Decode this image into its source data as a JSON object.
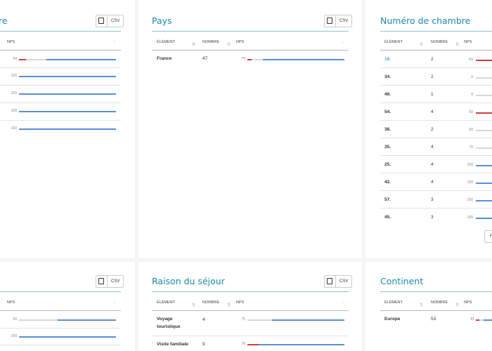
{
  "export": {
    "csv_label": "CSV"
  },
  "headers": {
    "element": "ÉLÉMENT",
    "count": "NOMBRE",
    "nps": "NPS",
    "sort_up": "↑",
    "sort_both": "⇅"
  },
  "card_top_left": {
    "title": "re",
    "rows": [
      {
        "nps": "64",
        "value": 64
      },
      {
        "nps": "100",
        "value": 100
      },
      {
        "nps": "100",
        "value": 100
      },
      {
        "nps": "100",
        "value": 100
      },
      {
        "nps": "100",
        "value": 100
      }
    ]
  },
  "card_pays": {
    "title": "Pays",
    "rows": [
      {
        "element": "France",
        "count": "47",
        "nps": "79",
        "value": 79
      }
    ]
  },
  "card_chambre": {
    "title": "Numéro de chambre",
    "pager_label": "F",
    "rows": [
      {
        "element": "16.",
        "count": "2",
        "nps": "-50",
        "value": -50
      },
      {
        "element": "34.",
        "count": "2",
        "nps": "0",
        "value": 0
      },
      {
        "element": "46.",
        "count": "1",
        "nps": "0",
        "value": 0
      },
      {
        "element": "54.",
        "count": "4",
        "nps": "50",
        "value": 50
      },
      {
        "element": "36.",
        "count": "2",
        "nps": "50",
        "value": 50
      },
      {
        "element": "35.",
        "count": "4",
        "nps": "75",
        "value": 75
      },
      {
        "element": "25.",
        "count": "4",
        "nps": "100",
        "value": 100
      },
      {
        "element": "42.",
        "count": "4",
        "nps": "100",
        "value": 100
      },
      {
        "element": "57.",
        "count": "3",
        "nps": "100",
        "value": 100
      },
      {
        "element": "45.",
        "count": "3",
        "nps": "100",
        "value": 100
      }
    ]
  },
  "card_bottom_left": {
    "rows": [
      {
        "nps": "60",
        "value": 60
      },
      {
        "nps": "100",
        "value": 100
      }
    ]
  },
  "card_raison": {
    "title": "Raison du séjour",
    "rows": [
      {
        "element": "Voyage touristique",
        "line1": "Voyage",
        "line2": "touristique",
        "count": "4",
        "nps": "75",
        "value": 75
      },
      {
        "element": "Visite familiale",
        "count": "9",
        "nps": "78",
        "value": 78
      }
    ]
  },
  "card_continent": {
    "title": "Continent",
    "rows": [
      {
        "element": "Europe",
        "count": "53",
        "nps": "81",
        "value": 81
      }
    ]
  },
  "colors": {
    "accent": "#1a8aa8",
    "positive": "#5b8ed6",
    "negative": "#d23b3b",
    "track": "#d7d7d7"
  }
}
